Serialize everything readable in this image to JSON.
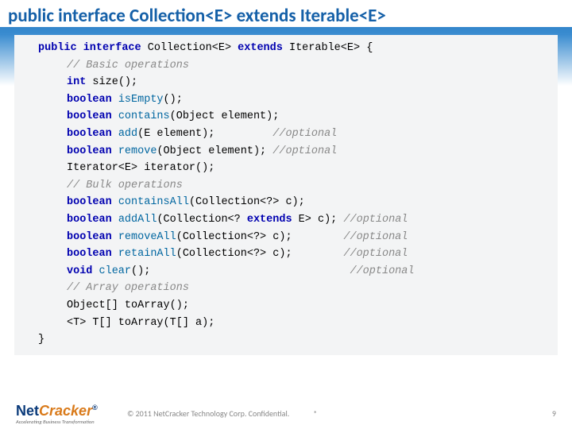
{
  "title": "public interface Collection<E> extends Iterable<E>",
  "code": {
    "l1": {
      "kw1": "public interface",
      "cls": " Collection<E> ",
      "kw2": "extends",
      "tail": " Iterable<E> {"
    },
    "l2": "// Basic operations",
    "l3": {
      "kw": "int",
      "tail": " size();"
    },
    "l4": {
      "kw": "boolean",
      "mth": " isEmpty",
      "tail": "();"
    },
    "l5": {
      "kw": "boolean",
      "mth": " contains",
      "tail": "(Object element);"
    },
    "l6": {
      "kw": "boolean",
      "mth": " add",
      "tail": "(E element);         ",
      "cmt": "//optional"
    },
    "l7": {
      "kw": "boolean",
      "mth": " remove",
      "tail": "(Object element); ",
      "cmt": "//optional"
    },
    "l8": "Iterator<E> iterator();",
    "l9": "",
    "l10": "// Bulk operations",
    "l11": {
      "kw": "boolean",
      "mth": " containsAll",
      "tail": "(Collection<?> c);"
    },
    "l12": {
      "kw": "boolean",
      "mth": " addAll",
      "tail": "(Collection<? ",
      "kw2": "extends",
      "tail2": " E> c); ",
      "cmt": "//optional"
    },
    "l13": {
      "kw": "boolean",
      "mth": " removeAll",
      "tail": "(Collection<?> c);        ",
      "cmt": "//optional"
    },
    "l14": {
      "kw": "boolean",
      "mth": " retainAll",
      "tail": "(Collection<?> c);        ",
      "cmt": "//optional"
    },
    "l15": {
      "kw": "void",
      "mth": " clear",
      "tail": "();                               ",
      "cmt": "//optional"
    },
    "l16": "",
    "l17": "// Array operations",
    "l18": "Object[] toArray();",
    "l19": "<T> T[] toArray(T[] a);",
    "l20": "}"
  },
  "footer": {
    "logo_main_a": "Net",
    "logo_main_b": "Cracker",
    "logo_sub": "Accelerating Business Transformation",
    "copyright": "© 2011 NetCracker Technology Corp. Confidential.",
    "asterisk": "*",
    "page": "9"
  }
}
